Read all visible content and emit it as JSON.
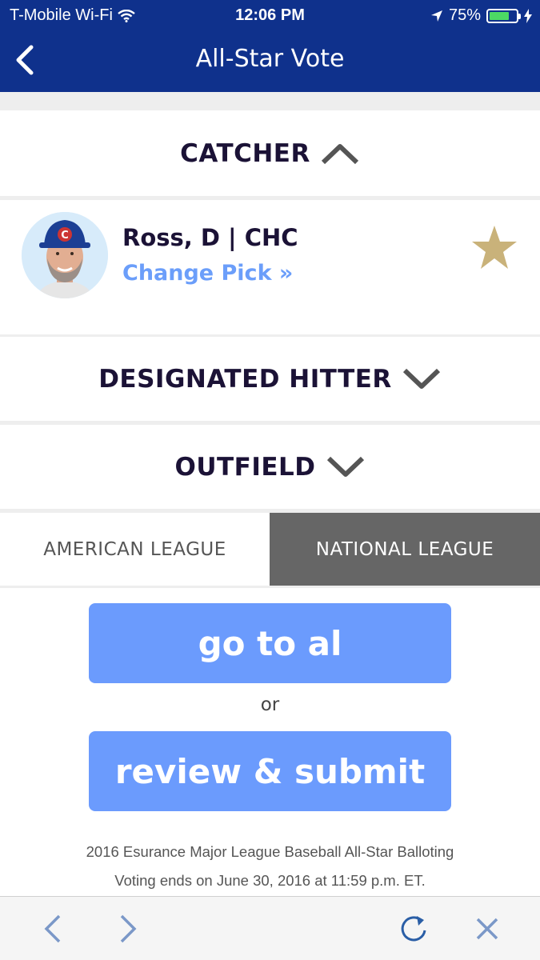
{
  "status": {
    "carrier": "T-Mobile Wi-Fi",
    "time": "12:06 PM",
    "battery_percent": "75%",
    "battery_level": 0.75,
    "battery_color": "#4cd964"
  },
  "nav": {
    "back_icon": "chevron-left-icon",
    "title": "All-Star Vote",
    "bar_color": "#0f318c"
  },
  "sections": {
    "catcher": {
      "label": "CATCHER",
      "icon": "chevron-up-icon"
    },
    "dh": {
      "label": "DESIGNATED HITTER",
      "icon": "chevron-down-icon"
    },
    "outfield": {
      "label": "OUTFIELD",
      "icon": "chevron-down-icon"
    }
  },
  "player": {
    "name": "Ross, D | CHC",
    "change_link": "Change Pick »",
    "favorite_icon": "star-icon",
    "star_color": "#c9b27a"
  },
  "leagues": {
    "american": "AMERICAN LEAGUE",
    "national": "NATIONAL LEAGUE",
    "selected": "national"
  },
  "actions": {
    "go_to_al": "go to al",
    "or": "or",
    "review_submit": "review & submit",
    "button_color": "#6b9bfd"
  },
  "footer": {
    "line1": "2016 Esurance Major League Baseball All-Star Balloting",
    "line2": "Voting ends on June 30, 2016 at 11:59 p.m. ET."
  },
  "browser": {
    "back_icon": "chevron-left-icon",
    "forward_icon": "chevron-right-icon",
    "reload_icon": "reload-icon",
    "close_icon": "close-icon"
  }
}
